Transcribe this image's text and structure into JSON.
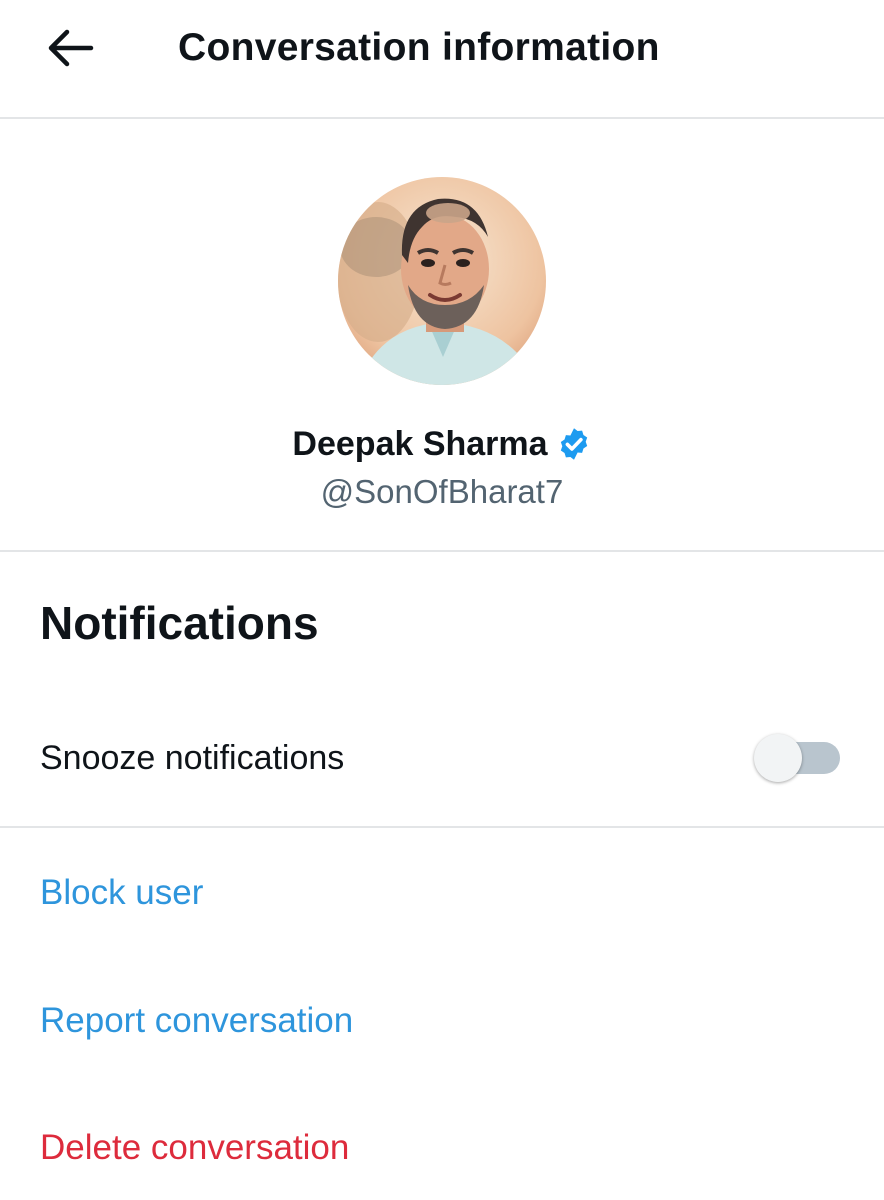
{
  "header": {
    "back_icon": "arrow-left-icon",
    "title": "Conversation information"
  },
  "profile": {
    "display_name": "Deepak Sharma",
    "handle": "@SonOfBharat7",
    "verified": true,
    "verified_icon": "verified-badge-icon",
    "verified_color": "#1d9bf0"
  },
  "notifications": {
    "heading": "Notifications",
    "snooze_label": "Snooze notifications",
    "snooze_enabled": false
  },
  "actions": {
    "block_user": "Block user",
    "report_conversation": "Report conversation",
    "delete_conversation": "Delete conversation"
  },
  "colors": {
    "link_blue": "#2e95dc",
    "danger_red": "#dd2b3c",
    "divider": "#e3e5e7",
    "secondary_text": "#536471"
  }
}
